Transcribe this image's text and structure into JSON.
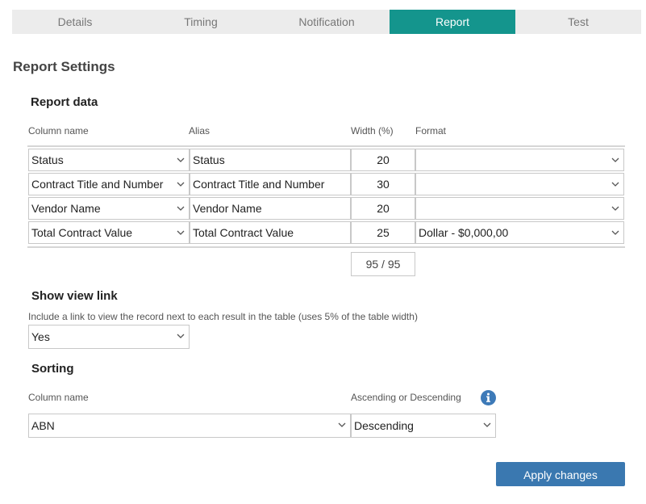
{
  "tabs": [
    {
      "label": "Details"
    },
    {
      "label": "Timing"
    },
    {
      "label": "Notification"
    },
    {
      "label": "Report",
      "active": true
    },
    {
      "label": "Test"
    }
  ],
  "page_title": "Report Settings",
  "report_data": {
    "title": "Report data",
    "headers": {
      "column_name": "Column name",
      "alias": "Alias",
      "width": "Width (%)",
      "format": "Format"
    },
    "rows": [
      {
        "column": "Status",
        "alias": "Status",
        "width": "20",
        "format": ""
      },
      {
        "column": "Contract Title and Number",
        "alias": "Contract Title and Number",
        "width": "30",
        "format": ""
      },
      {
        "column": "Vendor Name",
        "alias": "Vendor Name",
        "width": "20",
        "format": ""
      },
      {
        "column": "Total Contract Value",
        "alias": "Total Contract Value",
        "width": "25",
        "format": "Dollar - $0,000,00"
      }
    ],
    "total": "95 / 95"
  },
  "view_link": {
    "title": "Show view link",
    "hint": "Include a link to view the record next to each result in the table (uses 5% of the table width)",
    "value": "Yes"
  },
  "sorting": {
    "title": "Sorting",
    "column_label": "Column name",
    "order_label": "Ascending or Descending",
    "column_value": "ABN",
    "order_value": "Descending"
  },
  "apply_label": "Apply changes",
  "colors": {
    "tab_active": "#14958d",
    "button": "#3a78b0",
    "info": "#3d7ab8"
  }
}
